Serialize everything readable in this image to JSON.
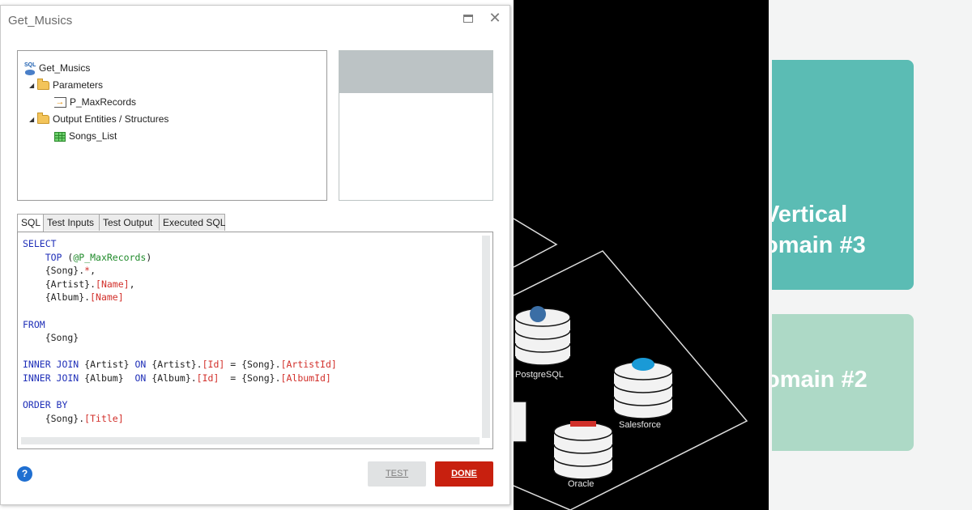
{
  "dialog": {
    "title": "Get_Musics",
    "tree": {
      "root": "Get_Musics",
      "parameters_folder": "Parameters",
      "parameter": "P_MaxRecords",
      "output_folder": "Output Entities / Structures",
      "output_entity": "Songs_List"
    },
    "tabs": [
      "SQL",
      "Test Inputs",
      "Test Output",
      "Executed SQL"
    ],
    "active_tab": "SQL",
    "sql_lines": [
      "SELECT",
      "    TOP (@P_MaxRecords)",
      "    {Song}.*,",
      "    {Artist}.[Name],",
      "    {Album}.[Name]",
      "",
      "FROM",
      "    {Song}",
      "",
      "INNER JOIN {Artist} ON {Artist}.[Id] = {Song}.[ArtistId]",
      "INNER JOIN {Album}  ON {Album}.[Id]  = {Song}.[AlbumId]",
      "",
      "ORDER BY",
      "    {Song}.[Title]"
    ],
    "help_label": "?",
    "test_label": "TEST",
    "done_label": "DONE"
  },
  "background": {
    "databases": [
      "PostgreSQL",
      "Salesforce",
      "Oracle"
    ],
    "cards": [
      "Vertical\nomain #3",
      "omain #2"
    ]
  },
  "colors": {
    "done_button": "#c8200f",
    "keyword": "#1f2fb8",
    "identifier": "#d2302b",
    "parameter": "#1f8a2a",
    "card_teal": "#5bbcb4",
    "card_mint": "#add9c6"
  },
  "icons": {
    "tree_root": "sql-database-icon",
    "folders": "folder-icon",
    "parameter": "input-parameter-icon",
    "entity": "table-icon",
    "maximize": "maximize-icon",
    "close": "close-icon",
    "help": "help-icon"
  }
}
